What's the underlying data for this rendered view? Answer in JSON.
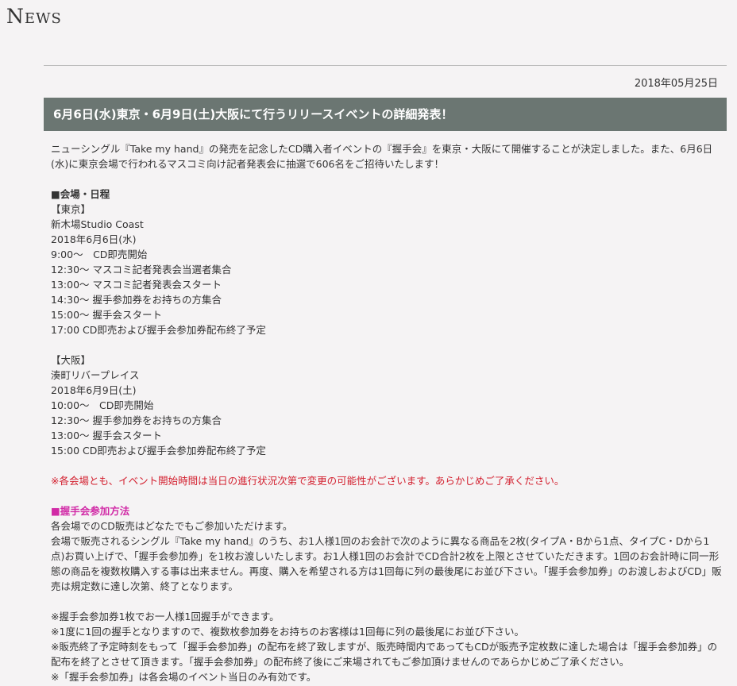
{
  "section_title": "News",
  "article": {
    "date": "2018年05月25日",
    "title": "6月6日(水)東京・6月9日(土)大阪にて行うリリースイベントの詳細発表！",
    "intro": "ニューシングル『Take my hand』の発売を記念したCD購入者イベントの『握手会』を東京・大阪にて開催することが決定しました。また、6月6日(水)に東京会場で行われるマスコミ向け記者発表会に抽選で606名をご招待いたします！",
    "venue_heading": "■会場・日程",
    "tokyo": {
      "label": "【東京】",
      "venue": "新木場Studio Coast",
      "date": "2018年6月6日(水)",
      "schedule": [
        "9:00～　CD即売開始",
        "12:30～ マスコミ記者発表会当選者集合",
        "13:00～ マスコミ記者発表会スタート",
        "14:30～ 握手参加券をお持ちの方集合",
        "15:00～ 握手会スタート",
        "17:00 CD即売および握手会参加券配布終了予定"
      ]
    },
    "osaka": {
      "label": "【大阪】",
      "venue": "湊町リバープレイス",
      "date": "2018年6月9日(土)",
      "schedule": [
        "10:00～　CD即売開始",
        "12:30～ 握手参加券をお持ちの方集合",
        "13:00～ 握手会スタート",
        "15:00 CD即売および握手会参加券配布終了予定"
      ]
    },
    "notice": "※各会場とも、イベント開始時間は当日の進行状況次第で変更の可能性がございます。あらかじめご了承ください。",
    "participation_heading": "■握手会参加方法",
    "participation_line1": "各会場でのCD販売はどなたでもご参加いただけます。",
    "participation_line2": "会場で販売されるシングル『Take my hand』のうち、お1人様1回のお会計で次のように異なる商品を2枚(タイプA・Bから1点、タイプC・Dから1点)お買い上げで、「握手会参加券」を1枚お渡しいたします。お1人様1回のお会計でCD合計2枚を上限とさせていただきます。1回のお会計時に同一形態の商品を複数枚購入する事は出来ません。再度、購入を希望される方は1回毎に列の最後尾にお並び下さい。「握手会参加券」のお渡しおよびCD」販売は規定数に達し次第、終了となります。",
    "notes": [
      "※握手会参加券1枚でお一人様1回握手ができます。",
      "※1度に1回の握手となりますので、複数枚参加券をお持ちのお客様は1回毎に列の最後尾にお並び下さい。",
      "※販売終了予定時刻をもって「握手会参加券」の配布を終了致しますが、販売時間内であってもCDが販売予定枚数に達した場合は「握手会参加券」の配布を終了とさせて頂きます。「握手会参加券」の配布終了後にご来場されてもご参加頂けませんのであらかじめご了承ください。",
      "※「握手会参加券」は各会場のイベント当日のみ有効です。"
    ]
  }
}
